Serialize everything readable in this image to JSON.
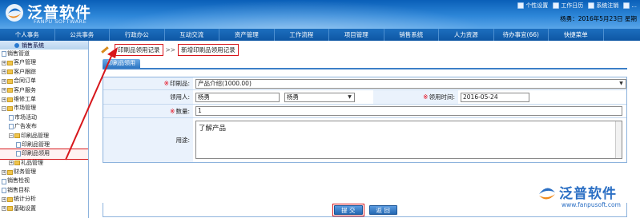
{
  "header": {
    "logo_cn": "泛普软件",
    "logo_en": "FANPU SOFTWARE",
    "top_links": [
      "个性设置",
      "工作日历",
      "系统注销",
      "..."
    ],
    "user_line": "杨勇：2016年5月23日 星期"
  },
  "nav": {
    "items": [
      "个人事务",
      "公共事务",
      "行政办公",
      "互动交流",
      "资产管理",
      "工作流程",
      "项目管理",
      "销售系统",
      "人力资源",
      "待办事宜(66)",
      "快捷菜单"
    ]
  },
  "sidebar": {
    "title": "销售系统",
    "items": [
      {
        "label": "销售管道",
        "level": 0,
        "kind": "leaf"
      },
      {
        "label": "客户管理",
        "level": 0,
        "kind": "plus"
      },
      {
        "label": "客户跟踪",
        "level": 0,
        "kind": "plus"
      },
      {
        "label": "合同订单",
        "level": 0,
        "kind": "plus"
      },
      {
        "label": "客户服务",
        "level": 0,
        "kind": "plus"
      },
      {
        "label": "维修工单",
        "level": 0,
        "kind": "plus"
      },
      {
        "label": "市场管理",
        "level": 0,
        "kind": "minus"
      },
      {
        "label": "市场活动",
        "level": 1,
        "kind": "leaf"
      },
      {
        "label": "广告发布",
        "level": 1,
        "kind": "leaf"
      },
      {
        "label": "印刷品管理",
        "level": 1,
        "kind": "minus"
      },
      {
        "label": "印刷品管理",
        "level": 2,
        "kind": "leaf"
      },
      {
        "label": "印刷品领用",
        "level": 2,
        "kind": "leaf",
        "highlight": true
      },
      {
        "label": "礼品管理",
        "level": 1,
        "kind": "plus"
      },
      {
        "label": "财务管理",
        "level": 0,
        "kind": "plus"
      },
      {
        "label": "销售检视",
        "level": 0,
        "kind": "leaf"
      },
      {
        "label": "销售目标",
        "level": 0,
        "kind": "leaf"
      },
      {
        "label": "统计分析",
        "level": 0,
        "kind": "plus"
      },
      {
        "label": "基础设置",
        "level": 0,
        "kind": "plus"
      }
    ]
  },
  "breadcrumb": {
    "first": "印刷品领用记录",
    "sep": ">>",
    "second": "新增印刷品领用记录"
  },
  "tab": {
    "label": "印刷品领用"
  },
  "form": {
    "item_label": "印刷品:",
    "item_value": "产品介绍(1000.00)",
    "recipient_label": "领用人:",
    "recipient_value": "杨勇",
    "recipient_select": "杨勇",
    "time_label": "领用时间:",
    "time_value": "2016-05-24",
    "qty_label": "数量:",
    "qty_value": "1",
    "purpose_label": "用途:",
    "purpose_value": "了解产品"
  },
  "buttons": {
    "submit": "提 交",
    "back": "返 回"
  },
  "watermark": {
    "cn": "泛普软件",
    "url": "www.fanpusoft.com"
  },
  "colors": {
    "accent": "#2468b2",
    "annotation": "#d7161b",
    "required": "#e60012"
  }
}
